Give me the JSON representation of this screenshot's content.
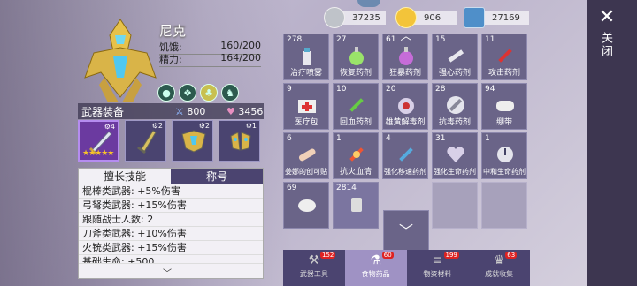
{
  "header": {
    "close_label": "关闭"
  },
  "resources": [
    {
      "value": "37235",
      "icon": "silver-coin-stack-icon"
    },
    {
      "value": "906",
      "icon": "gold-coin-icon"
    },
    {
      "value": "27169",
      "icon": "ticket-icon"
    }
  ],
  "character": {
    "name": "尼克",
    "hunger_label": "饥饿:",
    "hunger_value": "160/200",
    "energy_label": "精力:",
    "energy_value": "164/200"
  },
  "weapons": {
    "header": "武器装备",
    "attack": "800",
    "health": "3456",
    "slots": [
      {
        "badge": "4",
        "stars": "★★★★★",
        "active": true
      },
      {
        "badge": "2"
      },
      {
        "badge": "2"
      },
      {
        "badge": "1"
      }
    ]
  },
  "skills": {
    "tab_active": "擅长技能",
    "tab_inactive": "称号",
    "lines": [
      "棍棒类武器: +5%伤害",
      "弓弩类武器: +15%伤害",
      "跟随战士人数: 2",
      "刀斧类武器: +10%伤害",
      "火铳类武器: +15%伤害",
      "基础生命: +500"
    ]
  },
  "inventory": {
    "items": [
      {
        "count": "278",
        "label": "治疗喷雾"
      },
      {
        "count": "27",
        "label": "恢复药剂"
      },
      {
        "count": "61",
        "label": "狂暴药剂"
      },
      {
        "count": "15",
        "label": "强心药剂"
      },
      {
        "count": "11",
        "label": "攻击药剂"
      },
      {
        "count": "9",
        "label": "医疗包"
      },
      {
        "count": "10",
        "label": "回血药剂"
      },
      {
        "count": "20",
        "label": "雄黄解毒剂"
      },
      {
        "count": "28",
        "label": "抗毒药剂"
      },
      {
        "count": "94",
        "label": "绷带"
      },
      {
        "count": "6",
        "label": "姜娜的创可贴"
      },
      {
        "count": "1",
        "label": "抗火血清"
      },
      {
        "count": "4",
        "label": "强化移速药剂"
      },
      {
        "count": "31",
        "label": "强化生命药剂"
      },
      {
        "count": "1",
        "label": "中和生命药剂"
      },
      {
        "count": "69",
        "label": ""
      },
      {
        "count": "2814",
        "label": ""
      }
    ]
  },
  "bottom_tabs": [
    {
      "label": "武器工具",
      "badge": "152"
    },
    {
      "label": "食物药品",
      "badge": "60"
    },
    {
      "label": "物资材料",
      "badge": "199"
    },
    {
      "label": "成就收集",
      "badge": "63"
    }
  ],
  "colors": {
    "panel": "#6a6488",
    "dark_bar": "#3d3650",
    "tab_active": "#9f92c4",
    "badge_red": "#dd2222"
  }
}
